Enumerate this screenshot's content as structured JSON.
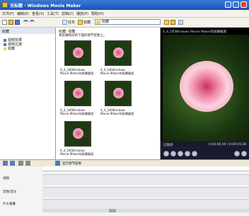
{
  "window": {
    "title": "无标题 - Windows Movie Maker"
  },
  "menu": [
    "文件(F)",
    "编辑(E)",
    "查看(V)",
    "工具(T)",
    "剪辑(C)",
    "播放(P)",
    "帮助(H)"
  ],
  "toolbar": {
    "tasks_label": "任务",
    "collections_label": "收藏",
    "combo_value": "收藏"
  },
  "tasks": {
    "header": "收藏",
    "items": [
      "视频效果",
      "视频过渡",
      "收藏"
    ]
  },
  "collection": {
    "title": "收藏: 收藏",
    "hint": "将剪辑拖动到下面的情节提要上。",
    "clips": [
      "4_4_1的Windows Movie Maker的屏幕截图",
      "4_4_1的Windows Movie Maker的屏幕截图",
      "4_4_1的Windows Movie Maker的屏幕截图",
      "4_4_1的Windows Movie Maker的屏幕截图",
      "4_4_1的Windows Movie Maker的屏幕截图"
    ]
  },
  "preview": {
    "title": "4_4_1的Windows Movie Maker的屏幕截图",
    "status": "已暂停",
    "time": "0:00:00.00 / 0:00:05.00"
  },
  "timeline": {
    "bar_label": "显示情节提要",
    "tracks": [
      "视频",
      "音频/音乐",
      "片头重叠"
    ]
  }
}
